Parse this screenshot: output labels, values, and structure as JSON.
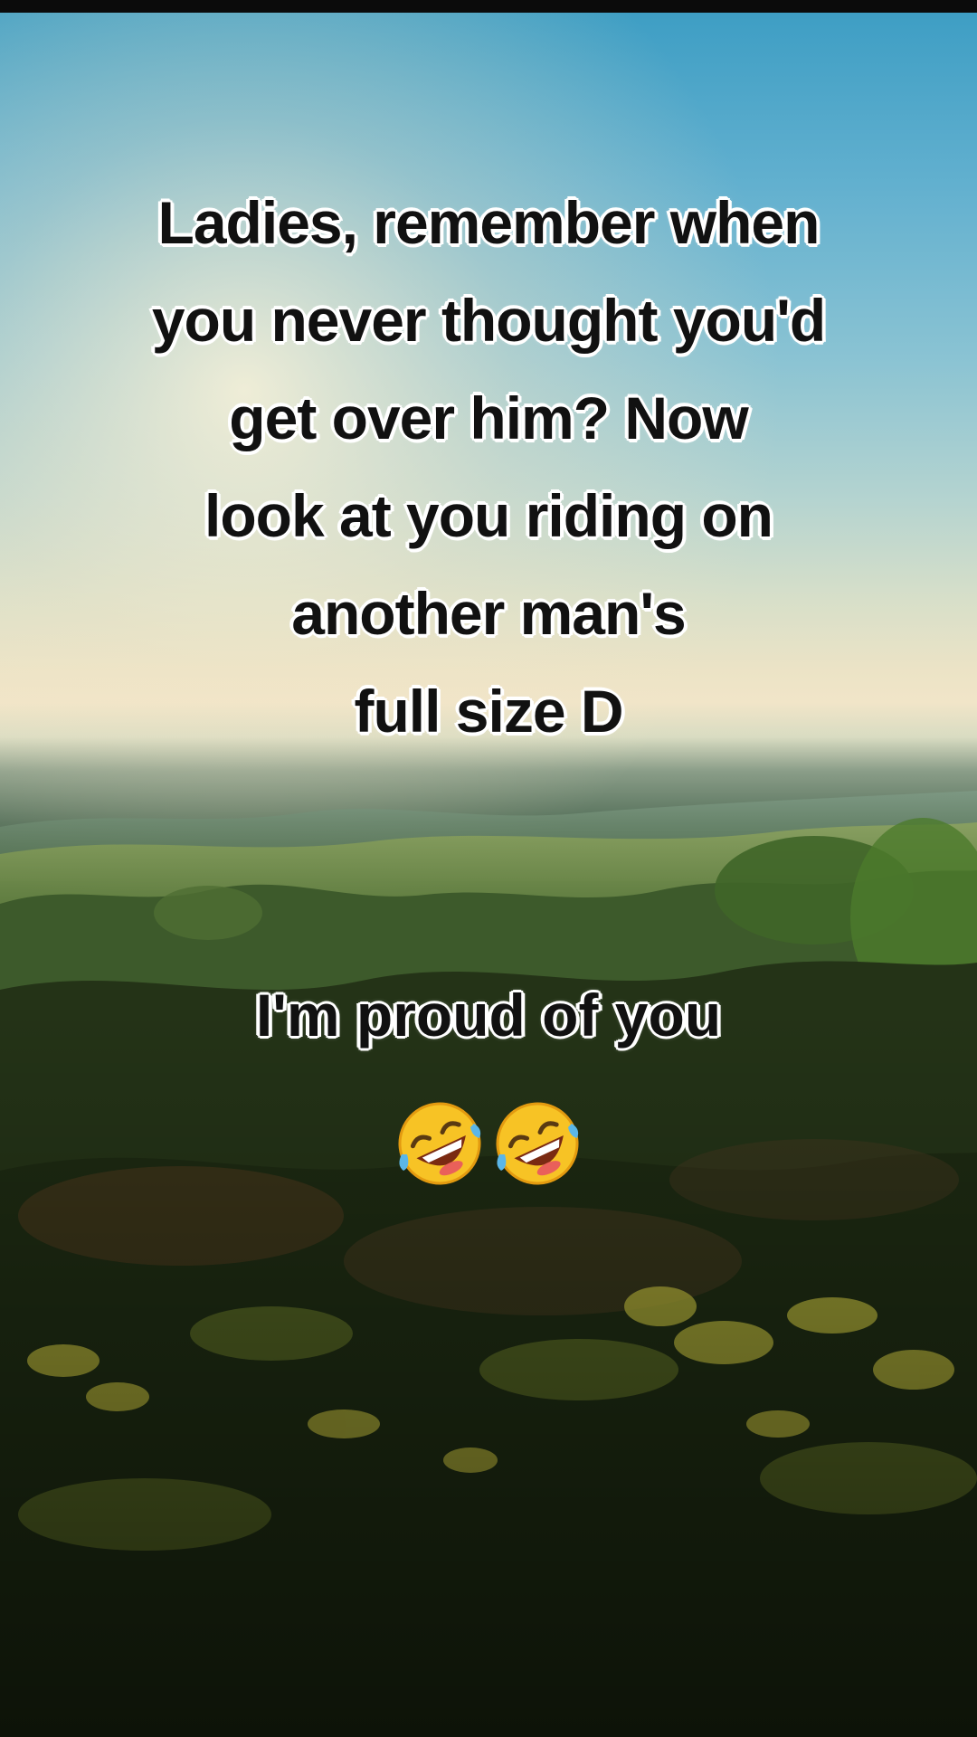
{
  "caption": {
    "lines": [
      "Ladies, remember when",
      "you never thought you'd",
      "get over him? Now",
      "look at you riding on",
      "another man's",
      "full size D"
    ],
    "subline": "I'm proud of you"
  },
  "emojis": [
    {
      "icon": "rolling-on-floor-laughing-emoji"
    },
    {
      "icon": "rolling-on-floor-laughing-emoji"
    }
  ],
  "colors": {
    "sky_top": "#3e9ec4",
    "horizon_glow": "#f1e5c8",
    "foliage_dark": "#141d0c",
    "caption_text": "#111111",
    "caption_outline": "#ffffff"
  }
}
